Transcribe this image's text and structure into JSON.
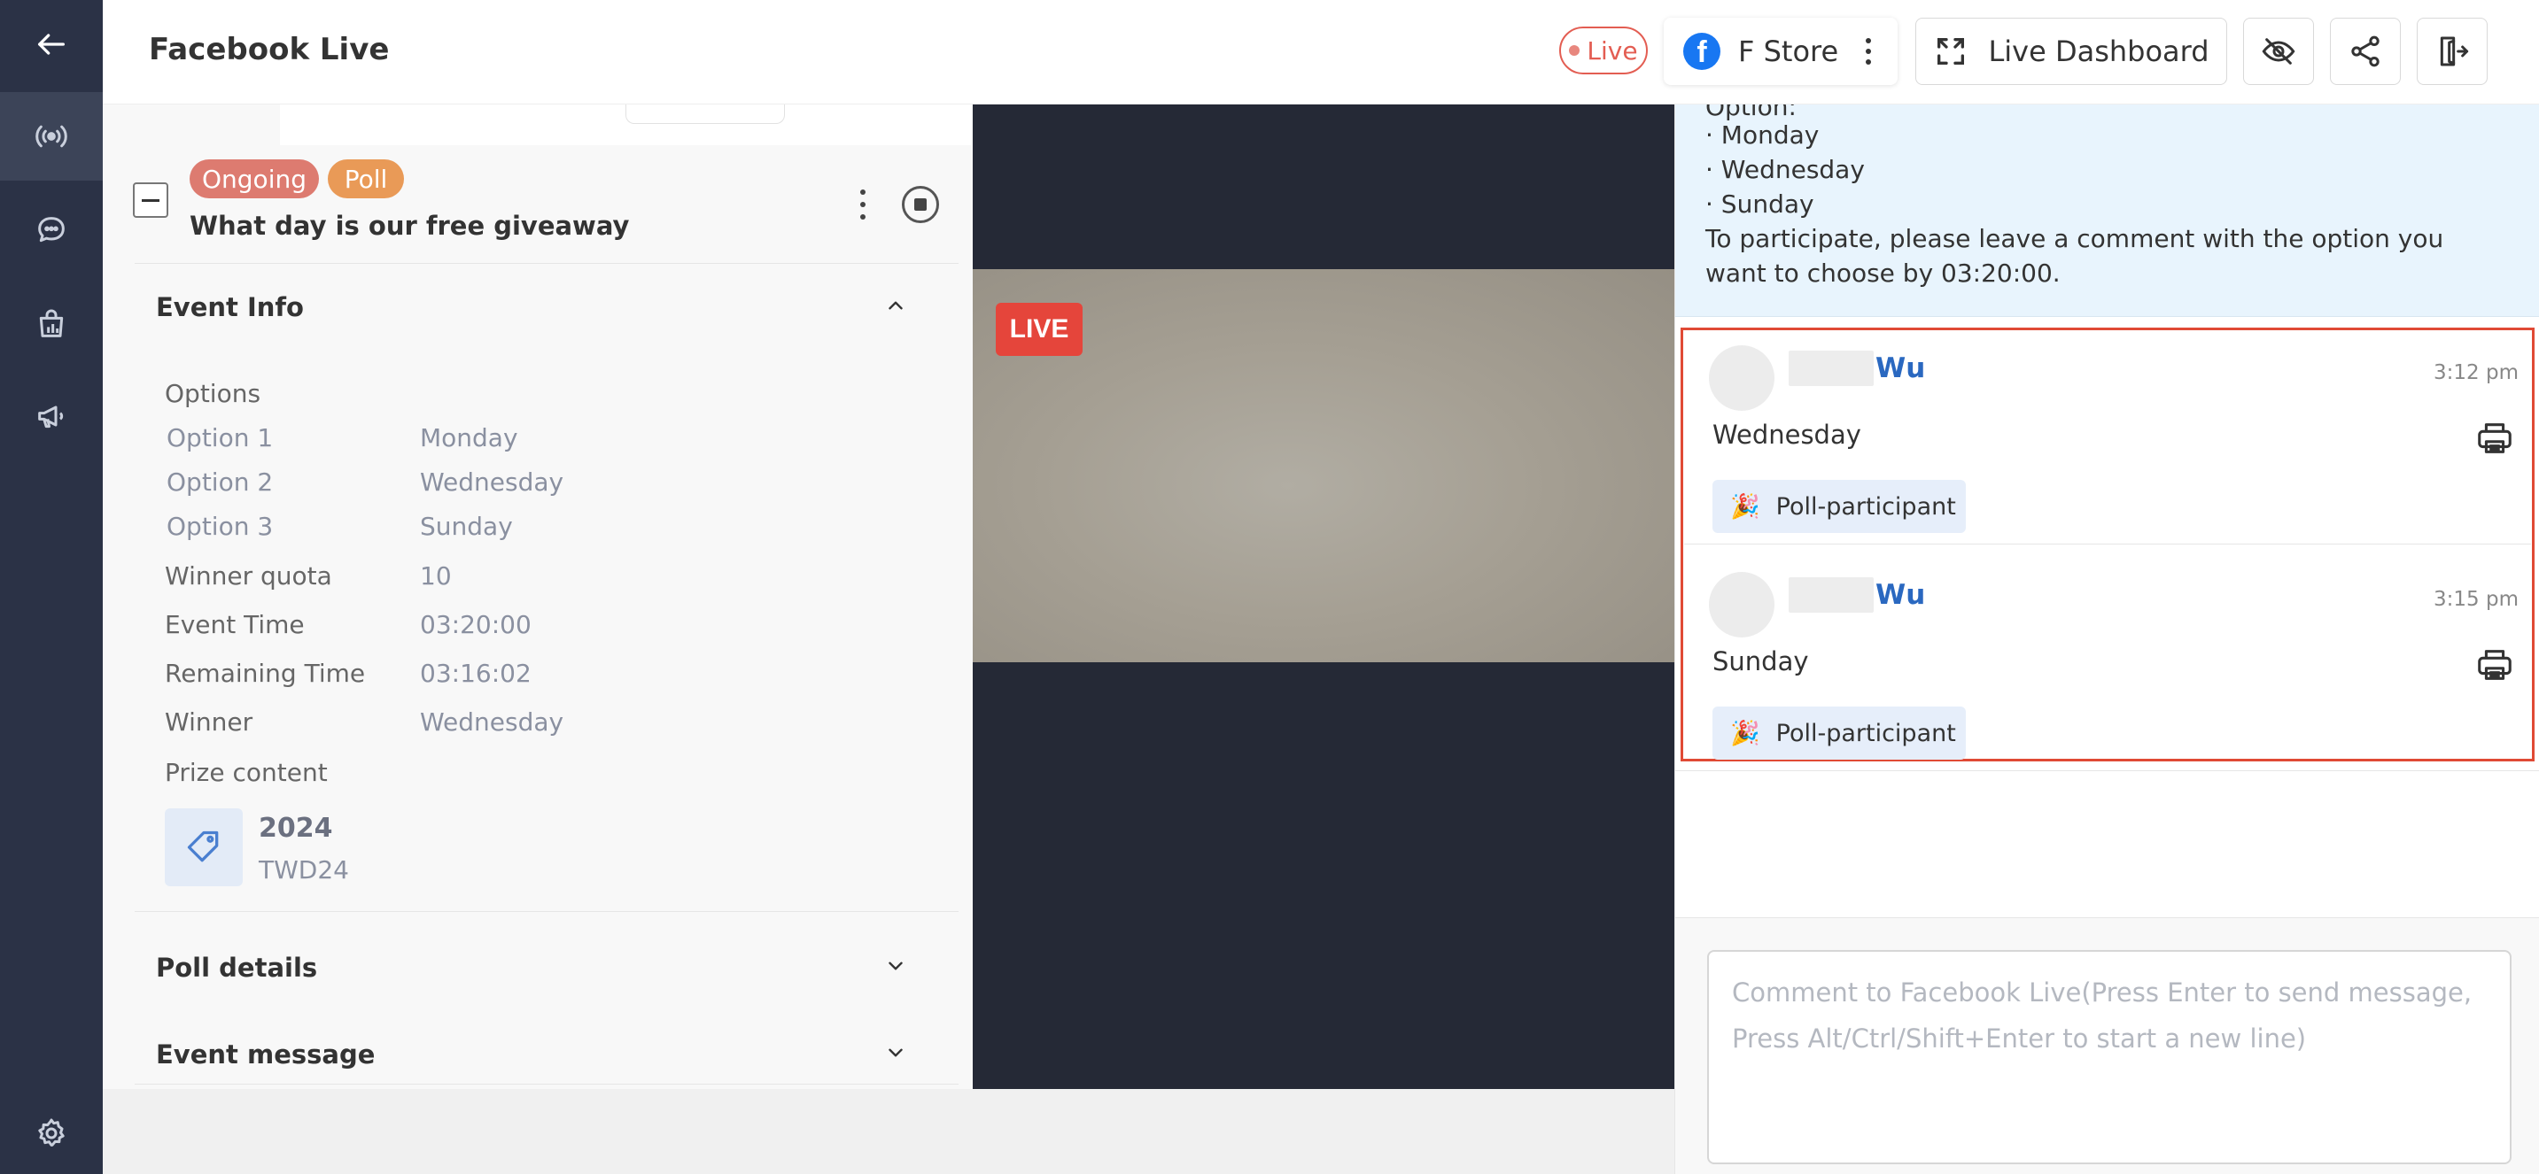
{
  "nav": {
    "items": [
      {
        "icon": "back-arrow-icon"
      },
      {
        "icon": "live-broadcast-icon"
      },
      {
        "icon": "chat-bubble-icon"
      },
      {
        "icon": "shopping-bag-icon"
      },
      {
        "icon": "megaphone-icon"
      },
      {
        "icon": "gear-icon"
      }
    ]
  },
  "header": {
    "title": "Facebook Live",
    "live_status": "Live",
    "store_name": "F Store",
    "dashboard_label": "Live Dashboard"
  },
  "event": {
    "badges": [
      "Ongoing",
      "Poll"
    ],
    "title": "What day is our free giveaway",
    "info_heading": "Event Info",
    "options_heading": "Options",
    "options": [
      {
        "label": "Option 1",
        "value": "Monday"
      },
      {
        "label": "Option 2",
        "value": "Wednesday"
      },
      {
        "label": "Option 3",
        "value": "Sunday"
      }
    ],
    "fields": [
      {
        "label": "Winner quota",
        "value": "10"
      },
      {
        "label": "Event Time",
        "value": "03:20:00"
      },
      {
        "label": "Remaining Time",
        "value": "03:16:02"
      },
      {
        "label": "Winner",
        "value": "Wednesday"
      }
    ],
    "prize_heading": "Prize content",
    "prize": {
      "name": "2024",
      "code": "TWD24"
    },
    "poll_details_heading": "Poll details",
    "event_message_heading": "Event message"
  },
  "video": {
    "live_badge": "LIVE"
  },
  "post": {
    "lines": [
      "Option:",
      "· Monday",
      "· Wednesday",
      "· Sunday",
      "To participate, please leave a comment with the option you",
      "want to choose by 03:20:00."
    ]
  },
  "comments": [
    {
      "name": "Wu",
      "time": "3:12 pm",
      "text": "Wednesday",
      "tag": "Poll-participant"
    },
    {
      "name": "Wu",
      "time": "3:15 pm",
      "text": "Sunday",
      "tag": "Poll-participant"
    }
  ],
  "comment_input": {
    "placeholder": "Comment to Facebook Live(Press Enter to send message, Press Alt/Ctrl/Shift+Enter to start a new line)"
  },
  "colors": {
    "nav_bg": "#2b3246",
    "live_red": "#e5453b",
    "ongoing_badge": "#dd7b70",
    "poll_badge": "#e99a57",
    "commenter_name": "#2a68c0",
    "highlight_border": "#e04a35"
  }
}
